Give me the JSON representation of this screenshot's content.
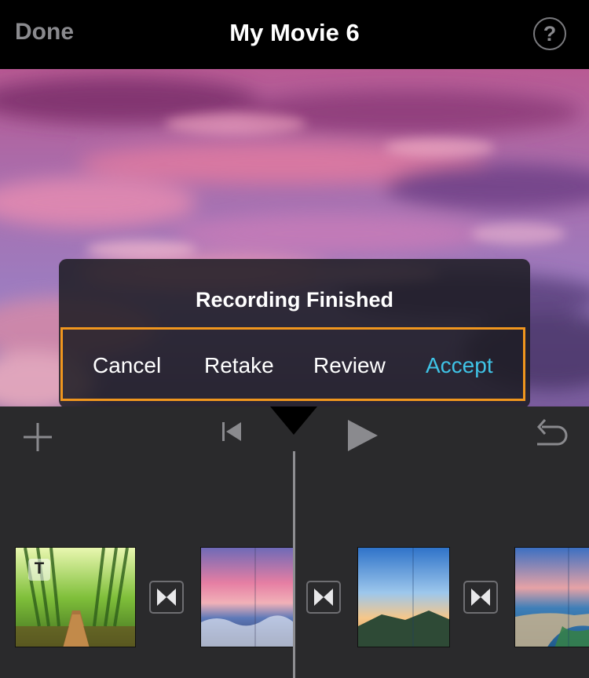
{
  "navbar": {
    "done_label": "Done",
    "title": "My Movie 6",
    "help_glyph": "?"
  },
  "dialog": {
    "title": "Recording Finished",
    "actions": {
      "cancel": "Cancel",
      "retake": "Retake",
      "review": "Review",
      "accept": "Accept"
    }
  },
  "toolbar": {
    "icons": [
      "add-icon",
      "skip-to-start-icon",
      "play-icon",
      "undo-icon"
    ]
  },
  "timeline": {
    "clips": [
      {
        "name": "bamboo-forest-clip",
        "badge": "T"
      },
      {
        "name": "sunset-sea-clip"
      },
      {
        "name": "mountain-sky-clip"
      },
      {
        "name": "coastline-clip"
      }
    ],
    "transition_icon": "bowtie-transition-icon"
  },
  "colors": {
    "accent": "#3fc3e6",
    "highlight_border": "#f0961e",
    "background": "#2a2a2c",
    "navbar": "#000000"
  }
}
